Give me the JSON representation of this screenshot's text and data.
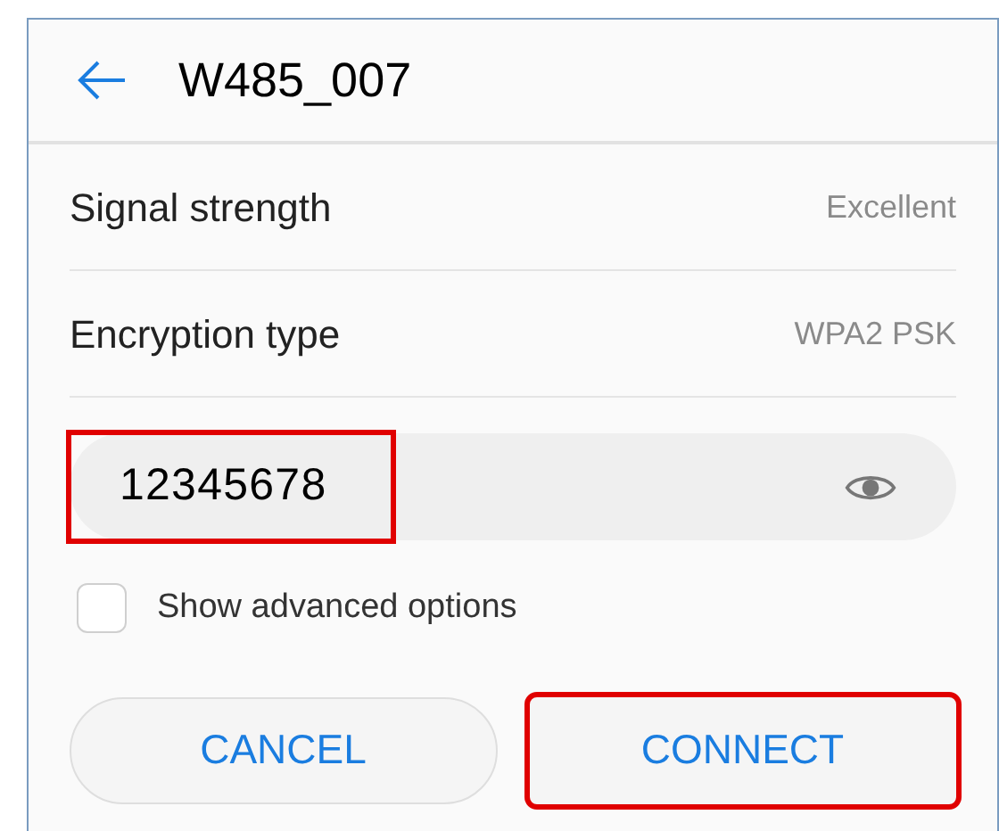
{
  "header": {
    "title": "W485_007"
  },
  "details": [
    {
      "label": "Signal strength",
      "value": "Excellent"
    },
    {
      "label": "Encryption type",
      "value": "WPA2 PSK"
    }
  ],
  "password": {
    "value": "12345678",
    "highlighted": true
  },
  "advanced_options": {
    "label": "Show advanced options",
    "checked": false
  },
  "buttons": [
    {
      "label": "CANCEL",
      "highlighted": false
    },
    {
      "label": "CONNECT",
      "highlighted": true
    }
  ]
}
